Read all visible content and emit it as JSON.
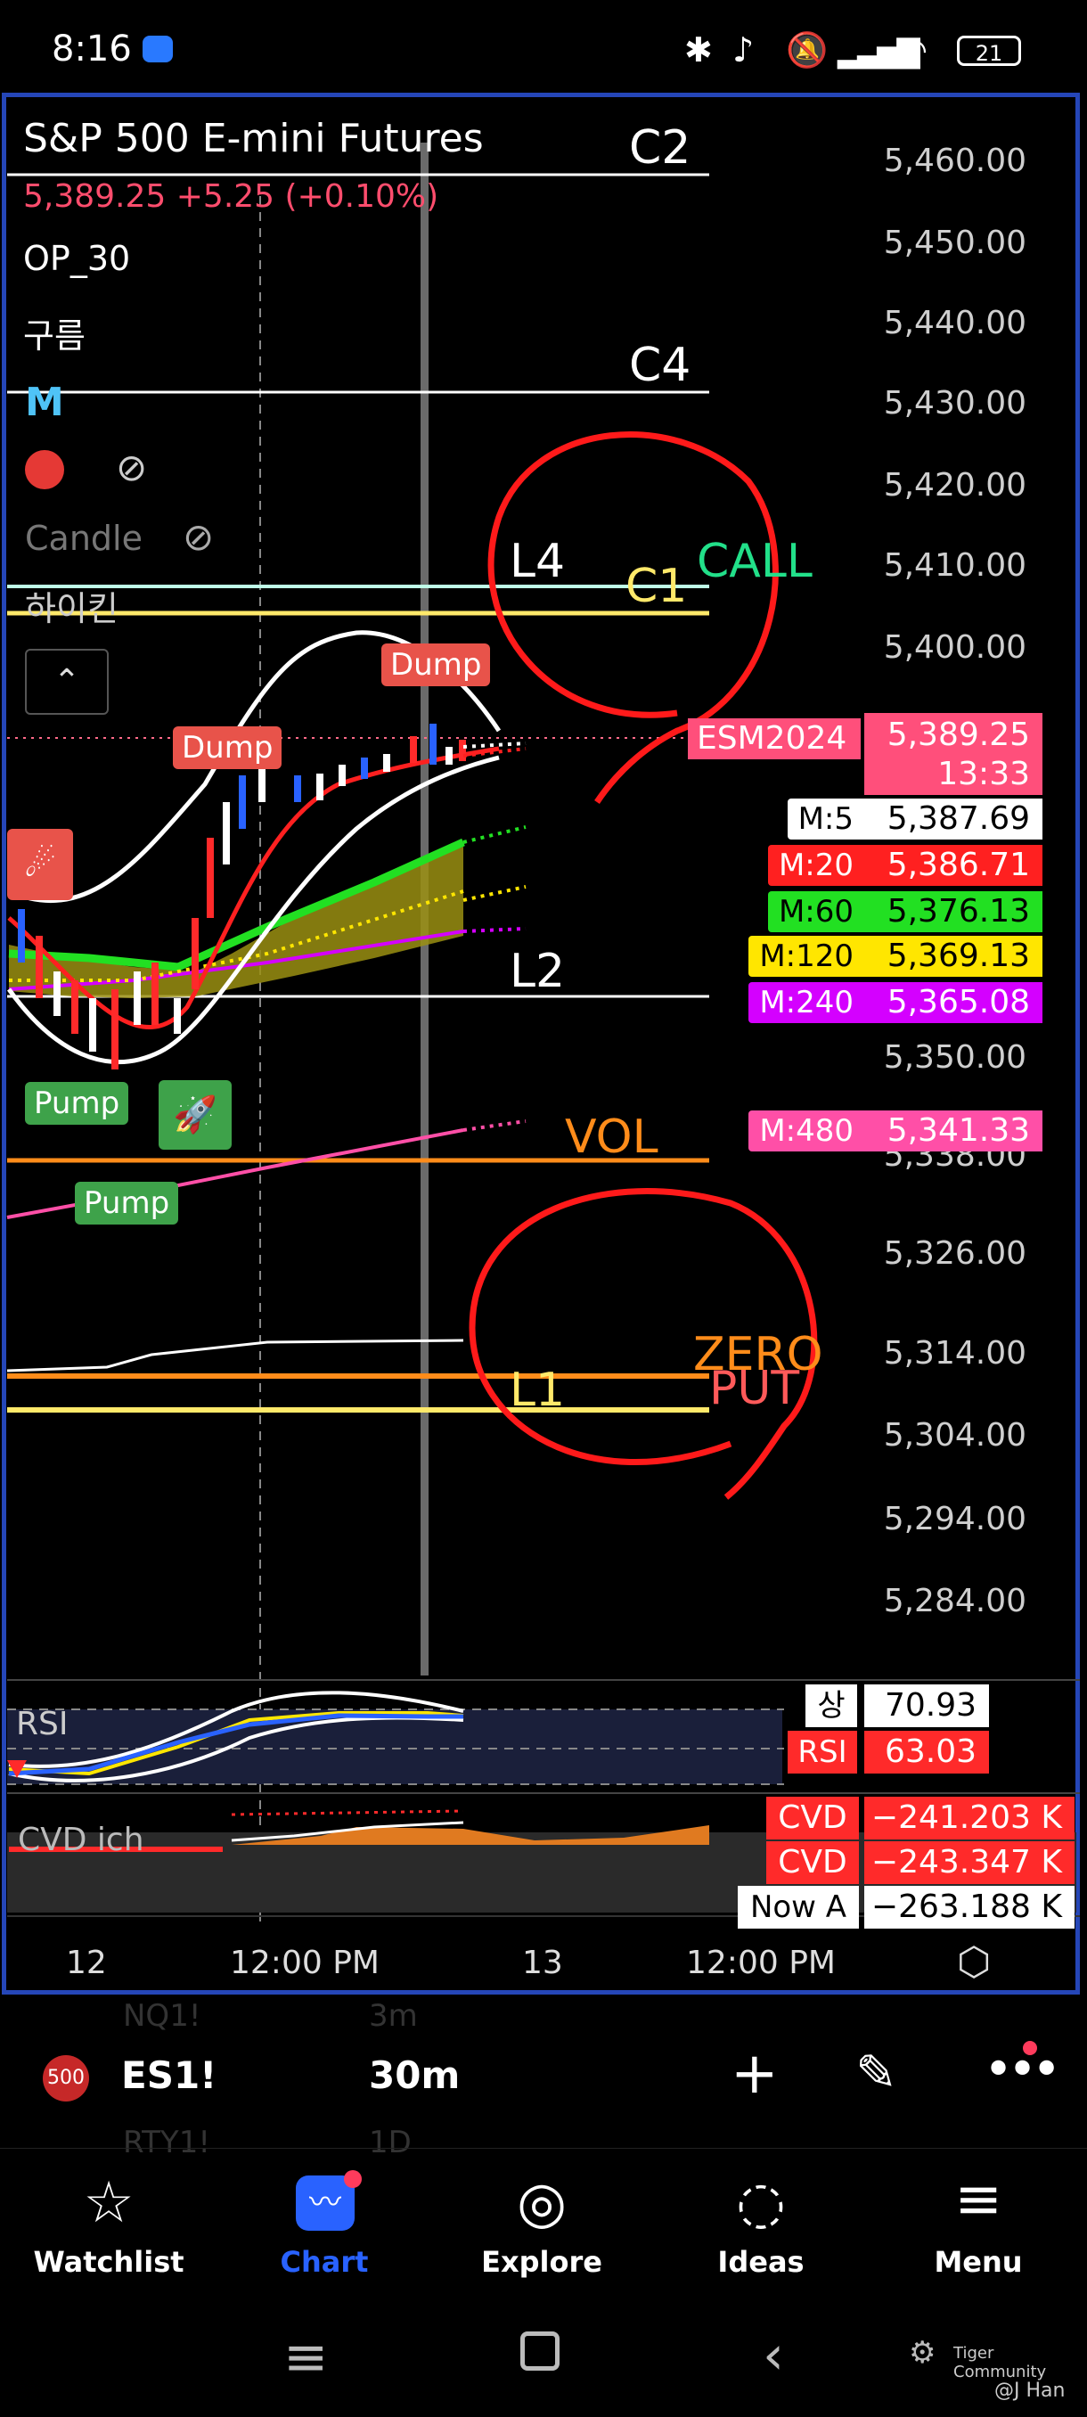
{
  "status_bar": {
    "time": "8:16",
    "battery": "21"
  },
  "chart": {
    "symbol_title": "S&P 500 E-mini Futures",
    "price_change": "5,389.25  +5.25 (+0.10%)",
    "indicators": [
      "OP_30",
      "구름"
    ],
    "m_label": "M",
    "candle_label": "Candle",
    "heikin_label": "하이킨",
    "level_labels": {
      "c2": "C2",
      "c4": "C4",
      "l4": "L4",
      "c1": "C1",
      "call": "CALL",
      "l2": "L2",
      "vol": "VOL",
      "zero": "ZERO",
      "put": "PUT",
      "l1": "L1"
    },
    "price_axis": [
      "5,460.00",
      "5,450.00",
      "5,440.00",
      "5,430.00",
      "5,420.00",
      "5,410.00",
      "5,400.00",
      "5,350.00",
      "5,338.00",
      "5,326.00",
      "5,314.00",
      "5,304.00",
      "5,294.00",
      "5,284.00"
    ],
    "contract_tag": "ESM2024",
    "last_price": "5,389.25",
    "countdown": "13:33",
    "moving_averages": [
      {
        "label": "M:5",
        "value": "5,387.69",
        "bg": "#ffffff",
        "fg": "#000000"
      },
      {
        "label": "M:20",
        "value": "5,386.71",
        "bg": "#ff2020",
        "fg": "#ffffff"
      },
      {
        "label": "M:60",
        "value": "5,376.13",
        "bg": "#22e022",
        "fg": "#000000"
      },
      {
        "label": "M:120",
        "value": "5,369.13",
        "bg": "#ffe600",
        "fg": "#000000"
      },
      {
        "label": "M:240",
        "value": "5,365.08",
        "bg": "#d400ff",
        "fg": "#ffffff"
      },
      {
        "label": "M:480",
        "value": "5,341.33",
        "bg": "#ff4fa7",
        "fg": "#ffffff"
      }
    ],
    "bubbles": {
      "dump1": "Dump",
      "dump2": "Dump",
      "pump1": "Pump",
      "pump2": "Pump"
    },
    "rsi": {
      "name": "RSI",
      "upper_label": "상",
      "upper_value": "70.93",
      "rsi_label": "RSI",
      "rsi_value": "63.03"
    },
    "cvd": {
      "name": "CVD ich",
      "row1_label": "CVD",
      "row1_value": "−241.203 K",
      "row2_label": "CVD",
      "row2_value": "−243.347 K",
      "row3_label": "Now A",
      "row3_value": "−263.188 K"
    },
    "time_axis": [
      "12",
      "12:00 PM",
      "13",
      "12:00 PM"
    ]
  },
  "toolbar": {
    "badge": "500",
    "symbol": "ES1!",
    "interval": "30m",
    "behind_top": "NQ1!",
    "behind_top_interval": "3m",
    "behind_bottom": "RTY1!",
    "behind_bottom_interval": "1D"
  },
  "nav": [
    {
      "label": "Watchlist"
    },
    {
      "label": "Chart"
    },
    {
      "label": "Explore"
    },
    {
      "label": "Ideas"
    },
    {
      "label": "Menu"
    }
  ],
  "watermark": {
    "brand": "Tiger Community",
    "author": "@J Han"
  },
  "colors": {
    "accent": "#2962ff",
    "frame": "#2546b8",
    "up": "#26a69a",
    "down": "#ff2a2a"
  }
}
